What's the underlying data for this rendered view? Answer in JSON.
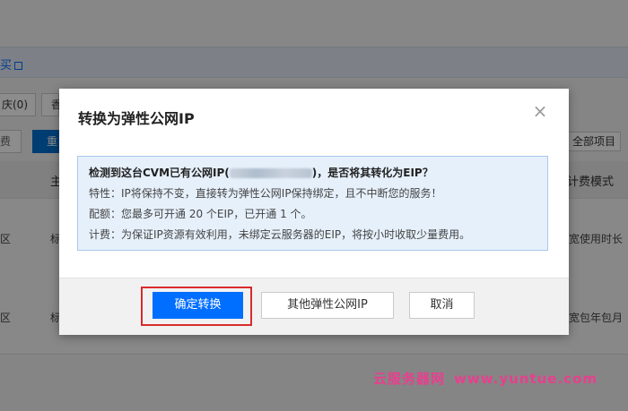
{
  "background": {
    "buy_link": "买",
    "region_tab_1": "庆(0)",
    "region_tab_2": "香",
    "button_gray": "费",
    "button_blue": "重",
    "all_projects": "全部项目",
    "table_head_col1": "主",
    "table_head_col2": "计费模式",
    "rows": [
      {
        "region": "区",
        "name": "标",
        "billing": "宽使用时长"
      },
      {
        "region": "区",
        "name": "标",
        "billing": "宽包年包月"
      }
    ]
  },
  "dialog": {
    "title": "转换为弹性公网IP",
    "close_symbol": "×",
    "info": {
      "headline_prefix": "检测到这台CVM已有公网IP(",
      "headline_suffix": ")，是否将其转化为EIP？",
      "line_feature": "特性：IP将保持不变，直接转为弹性公网IP保持绑定，且不中断您的服务！",
      "line_quota": "配额：您最多可开通 20 个EIP，已开通 1 个。",
      "line_billing": "计费：为保证IP资源有效利用，未绑定云服务器的EIP，将按小时收取少量费用。"
    },
    "buttons": {
      "confirm": "确定转换",
      "other": "其他弹性公网IP",
      "cancel": "取消"
    }
  },
  "watermark": {
    "brand": "云服务器网",
    "url": "www.yuntue.com"
  },
  "colors": {
    "primary": "#006eff",
    "highlight": "#d92b2b",
    "info_bg": "#e6f0fb",
    "watermark": "#e83f8e"
  }
}
